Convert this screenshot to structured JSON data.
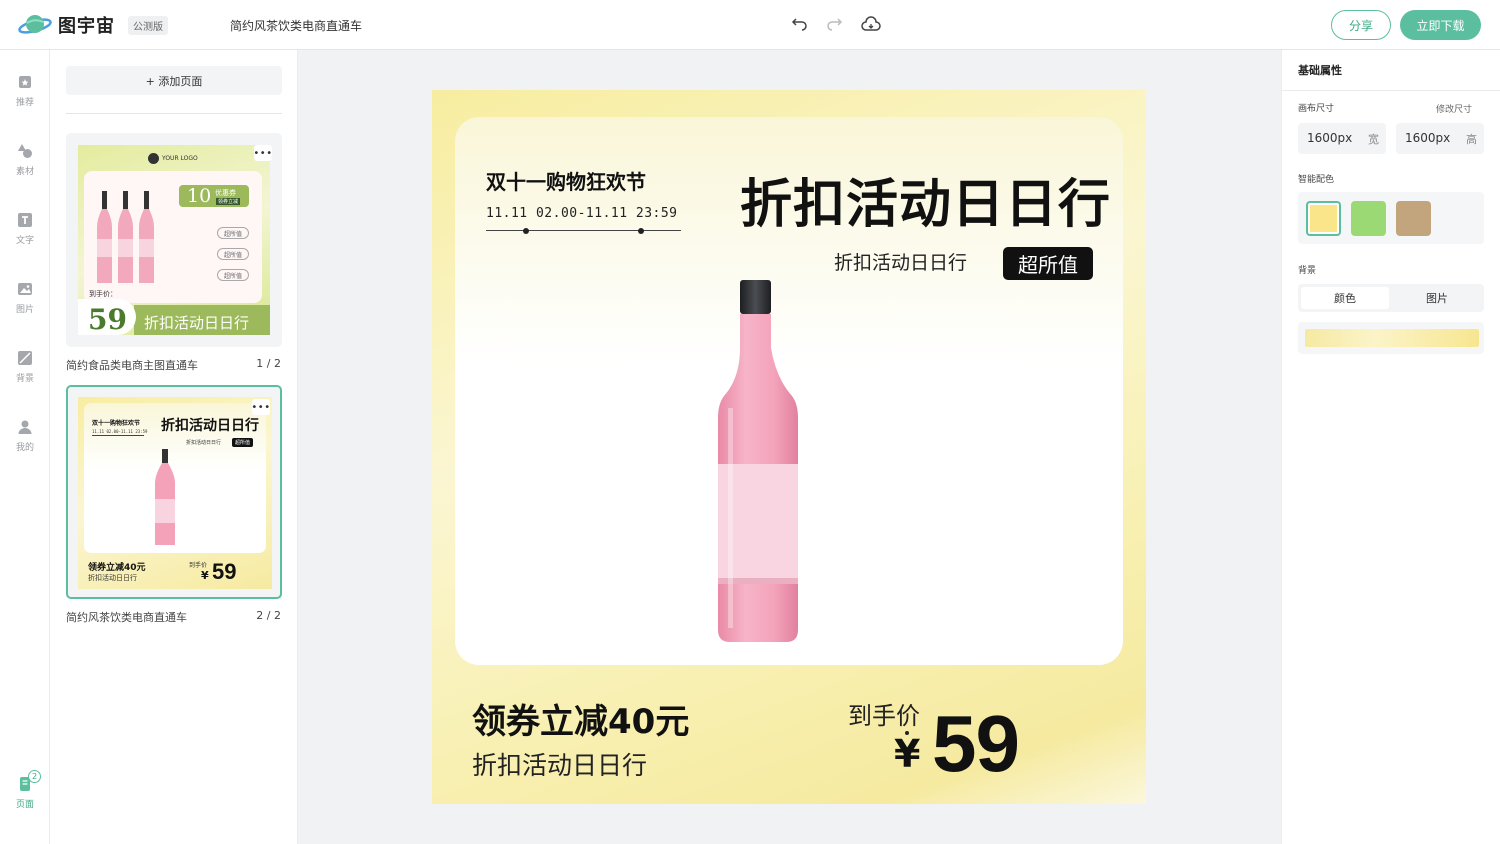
{
  "app": {
    "logo_text": "图宇宙",
    "beta_badge": "公测版",
    "document_title": "简约风茶饮类电商直通车",
    "share_label": "分享",
    "download_label": "立即下载"
  },
  "rail": {
    "items": [
      {
        "label": "推荐",
        "icon": "recommend-icon"
      },
      {
        "label": "素材",
        "icon": "shapes-icon"
      },
      {
        "label": "文字",
        "icon": "text-icon"
      },
      {
        "label": "图片",
        "icon": "image-icon"
      },
      {
        "label": "背景",
        "icon": "background-icon"
      },
      {
        "label": "我的",
        "icon": "user-icon"
      }
    ],
    "pages_label": "页面",
    "pages_count": "2"
  },
  "pages_panel": {
    "add_page_label": "+ 添加页面",
    "pages": [
      {
        "caption": "简约食品类电商主图直通车",
        "index": "1 / 2",
        "thumb": {
          "logo": "YOUR LOGO",
          "coupon_number": "10",
          "coupon_word": "优惠券",
          "coupon_sub": "领券立减",
          "tags": [
            "超所值",
            "超所值",
            "超所值"
          ],
          "price_label": "到手价：",
          "price": "59",
          "slogan": "折扣活动日日行"
        }
      },
      {
        "caption": "简约风茶饮类电商直通车",
        "index": "2 / 2",
        "thumb": {
          "event": "双十一购物狂欢节",
          "time": "11.11 02.00-11.11 23:59",
          "title": "折扣活动日日行",
          "sub": "折扣活动日日行",
          "badge": "超所值",
          "coupon": "领券立减40元",
          "coupon_sub": "折扣活动日日行",
          "price_label": "到手价",
          "price": "59"
        }
      }
    ]
  },
  "canvas": {
    "event_title": "双十一购物狂欢节",
    "event_time": "11.11 02.00-11.11 23:59",
    "main_title": "折扣活动日日行",
    "sub_title": "折扣活动日日行",
    "badge": "超所值",
    "coupon": "领券立减40元",
    "coupon_sub": "折扣活动日日行",
    "price_label": "到手价",
    "currency": "¥",
    "price": "59"
  },
  "properties": {
    "header": "基础属性",
    "canvas_size_label": "画布尺寸",
    "resize_link": "修改尺寸",
    "width_value": "1600px",
    "width_unit": "宽",
    "height_value": "1600px",
    "height_unit": "高",
    "smart_color_label": "智能配色",
    "swatches": [
      "#fbe58a",
      "#9ad974",
      "#c2a57c"
    ],
    "background_label": "背景",
    "bg_tabs": [
      "颜色",
      "图片"
    ],
    "bg_gradient": [
      "#f6e9a2",
      "#fbf4c8",
      "#f7e690"
    ]
  }
}
